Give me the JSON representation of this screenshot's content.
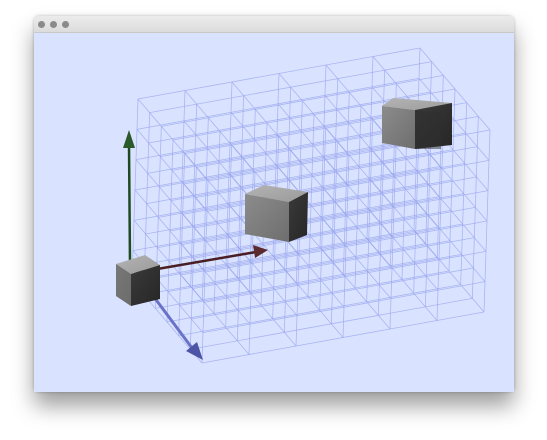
{
  "window": {
    "title": "",
    "background_color": "#d9e3ff"
  },
  "titlebar": {
    "buttons": [
      {
        "name": "close",
        "icon": "circle-icon"
      },
      {
        "name": "minimize",
        "icon": "circle-icon"
      },
      {
        "name": "maximize",
        "icon": "circle-icon"
      }
    ]
  },
  "scene": {
    "grid": {
      "divisions": 6,
      "color": "#9aa6ee"
    },
    "axes": {
      "y": {
        "label": "",
        "color": "#1f4a1f"
      },
      "x": {
        "label": "",
        "color": "#4a1f24"
      },
      "z": {
        "label": "",
        "color": "#6a72c8"
      }
    },
    "cubes": [
      {
        "name": "origin-cube"
      },
      {
        "name": "center-cube"
      },
      {
        "name": "far-cube"
      }
    ]
  }
}
